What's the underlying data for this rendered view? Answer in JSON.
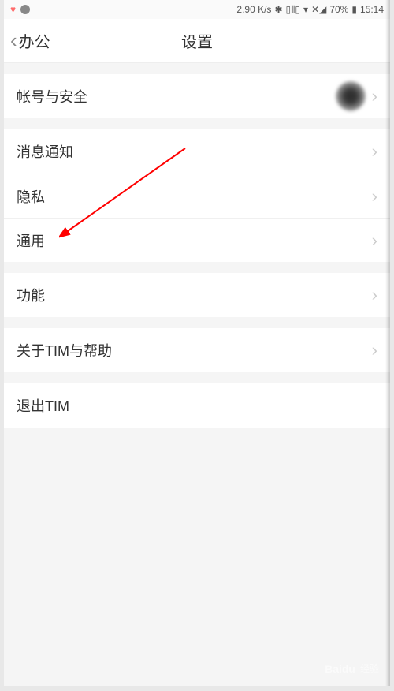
{
  "status_bar": {
    "speed": "2.90 K/s",
    "battery_pct": "70%",
    "time": "15:14"
  },
  "header": {
    "back_label": "办公",
    "title": "设置"
  },
  "groups": [
    {
      "items": [
        {
          "label": "帐号与安全",
          "has_avatar": true,
          "has_chevron": true
        }
      ]
    },
    {
      "items": [
        {
          "label": "消息通知",
          "has_chevron": true
        },
        {
          "label": "隐私",
          "has_chevron": true
        },
        {
          "label": "通用",
          "has_chevron": true
        }
      ]
    },
    {
      "items": [
        {
          "label": "功能",
          "has_chevron": true
        }
      ]
    },
    {
      "items": [
        {
          "label": "关于TIM与帮助",
          "has_chevron": true
        }
      ]
    },
    {
      "items": [
        {
          "label": "退出TIM",
          "has_chevron": false
        }
      ]
    }
  ],
  "watermark": {
    "logo": "Baidu",
    "sub": "经验"
  }
}
